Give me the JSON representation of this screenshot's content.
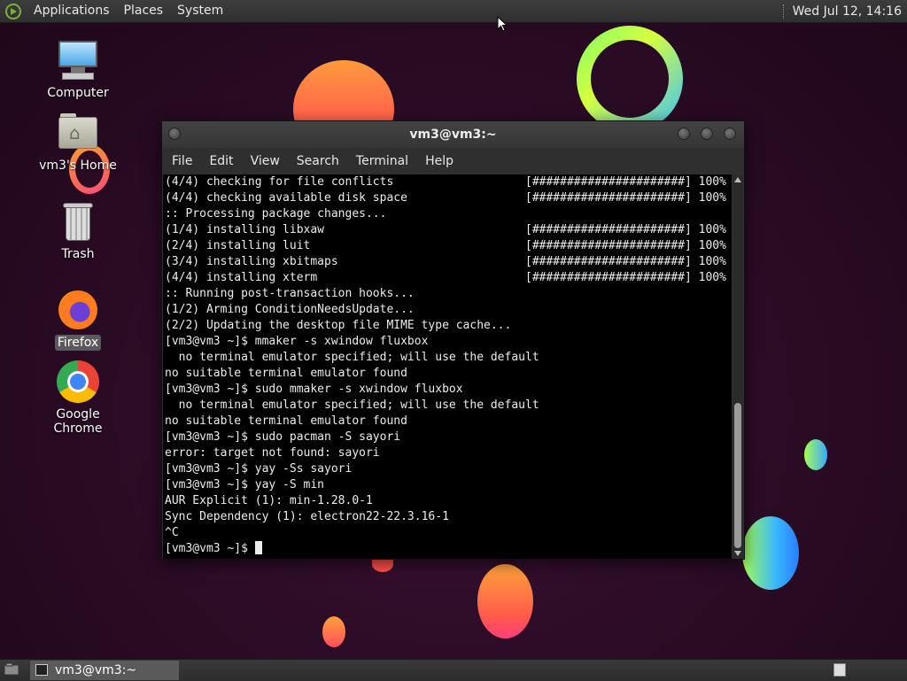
{
  "top_panel": {
    "menus": [
      "Applications",
      "Places",
      "System"
    ],
    "clock": "Wed Jul 12, 14:16"
  },
  "desktop_icons": [
    {
      "label": "Computer",
      "icon": "computer-icon"
    },
    {
      "label": "vm3's Home",
      "icon": "home-folder-icon"
    },
    {
      "label": "Trash",
      "icon": "trash-icon"
    },
    {
      "label": "Firefox",
      "icon": "firefox-icon",
      "selected": true
    },
    {
      "label": "Google Chrome",
      "icon": "chrome-icon"
    }
  ],
  "terminal": {
    "title": "vm3@vm3:~",
    "menu": [
      "File",
      "Edit",
      "View",
      "Search",
      "Terminal",
      "Help"
    ],
    "lines": [
      "(4/4) checking for file conflicts                   [######################] 100%",
      "(4/4) checking available disk space                 [######################] 100%",
      ":: Processing package changes...",
      "(1/4) installing libxaw                             [######################] 100%",
      "(2/4) installing luit                               [######################] 100%",
      "(3/4) installing xbitmaps                           [######################] 100%",
      "(4/4) installing xterm                              [######################] 100%",
      ":: Running post-transaction hooks...",
      "(1/2) Arming ConditionNeedsUpdate...",
      "(2/2) Updating the desktop file MIME type cache...",
      "[vm3@vm3 ~]$ mmaker -s xwindow fluxbox",
      "  no terminal emulator specified; will use the default",
      "no suitable terminal emulator found",
      "[vm3@vm3 ~]$ sudo mmaker -s xwindow fluxbox",
      "  no terminal emulator specified; will use the default",
      "no suitable terminal emulator found",
      "[vm3@vm3 ~]$ sudo pacman -S sayori",
      "error: target not found: sayori",
      "[vm3@vm3 ~]$ yay -Ss sayori",
      "[vm3@vm3 ~]$ yay -S min",
      "AUR Explicit (1): min-1.28.0-1",
      "Sync Dependency (1): electron22-22.3.16-1",
      "^C"
    ],
    "prompt": "[vm3@vm3 ~]$ "
  },
  "taskbar": {
    "tasks": [
      {
        "label": "vm3@vm3:~",
        "icon": "terminal-icon"
      }
    ]
  }
}
